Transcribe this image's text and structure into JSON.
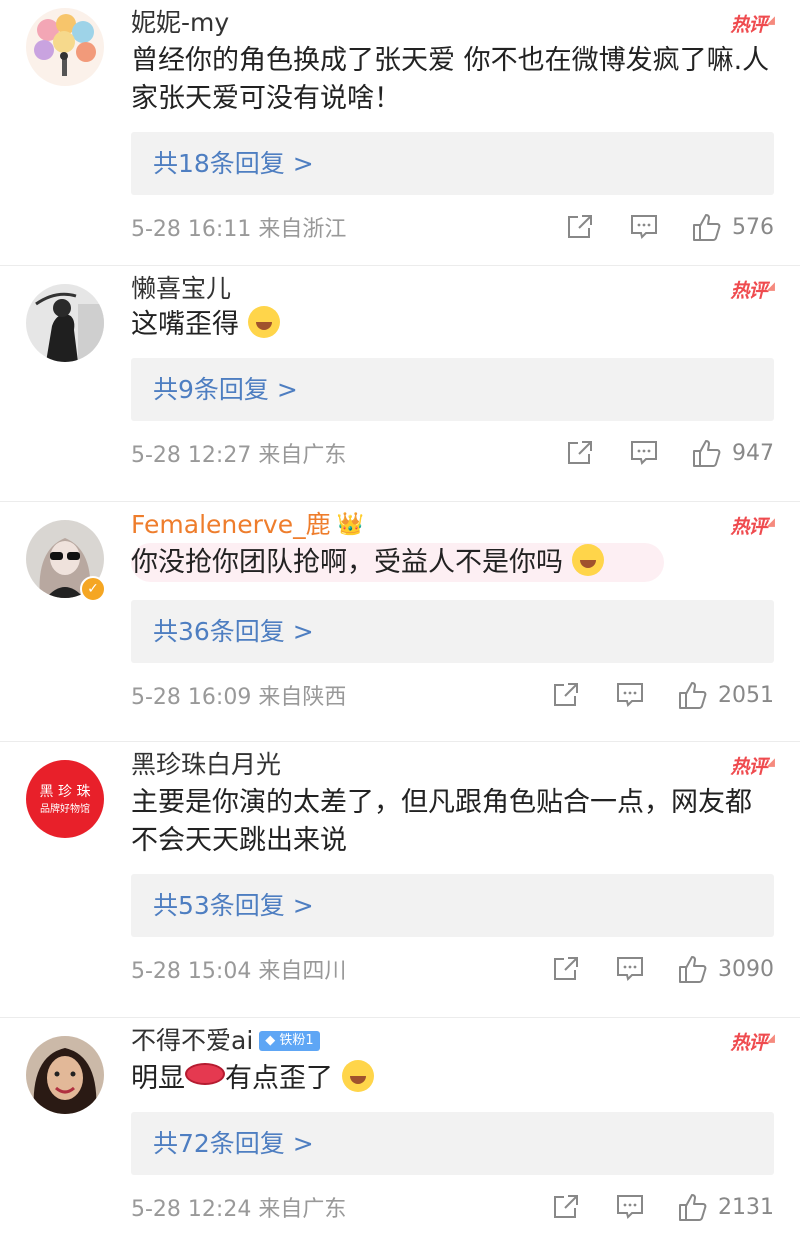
{
  "hot_label": "热评",
  "comments": [
    {
      "name": "妮妮-my",
      "text": "曾经你的角色换成了张天爱 你不也在微博发疯了嘛.人家张天爱可没有说啥！",
      "replies": "共18条回复 >",
      "time": "5-28 16:11",
      "location": "来自浙江",
      "likes": "576"
    },
    {
      "name": "懒喜宝儿",
      "text": "这嘴歪得",
      "replies": "共9条回复 >",
      "time": "5-28 12:27",
      "location": "来自广东",
      "likes": "947"
    },
    {
      "name": "Femalenerve_鹿",
      "text": "你没抢你团队抢啊，受益人不是你吗",
      "replies": "共36条回复 >",
      "time": "5-28 16:09",
      "location": "来自陕西",
      "likes": "2051"
    },
    {
      "name": "黑珍珠白月光",
      "avatar_text_top": "黑 珍 珠",
      "avatar_text_bottom": "品牌好物馆",
      "text": "主要是你演的太差了，但凡跟角色贴合一点，网友都不会天天跳出来说",
      "replies": "共53条回复 >",
      "time": "5-28 15:04",
      "location": "来自四川",
      "likes": "3090"
    },
    {
      "name": "不得不爱ai",
      "badge": "铁粉1",
      "text_a": "明显",
      "text_b": "有点歪了",
      "replies": "共72条回复 >",
      "time": "5-28 12:24",
      "location": "来自广东",
      "likes": "2131"
    }
  ],
  "colors": {
    "reply_link": "#4e7ec1",
    "hot_red": "#ef4b4f",
    "vip_orange": "#ee7d2c"
  }
}
